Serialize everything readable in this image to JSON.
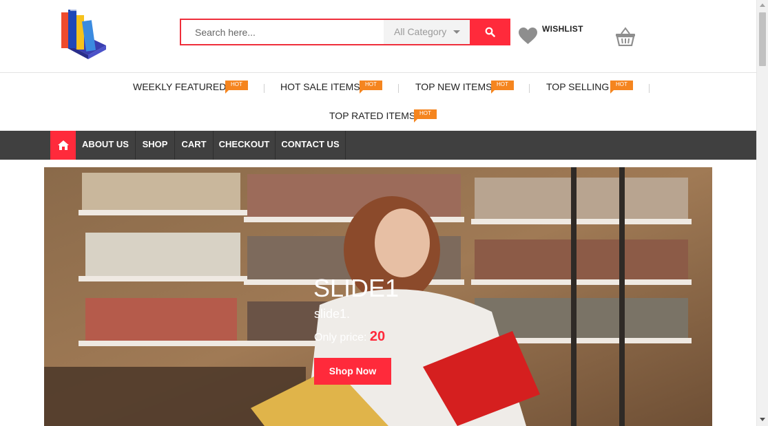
{
  "header": {
    "logo_icon": "books-logo-icon",
    "search": {
      "placeholder": "Search here...",
      "category": "All Category",
      "button_icon": "search-icon"
    },
    "wishlist": {
      "label": "WISHLIST",
      "icon": "heart-icon"
    },
    "cart": {
      "icon": "basket-icon"
    }
  },
  "category_nav": {
    "items": [
      {
        "label": "WEEKLY FEATURED",
        "badge": "HOT"
      },
      {
        "label": "HOT SALE ITEMS",
        "badge": "HOT"
      },
      {
        "label": "TOP NEW ITEMS",
        "badge": "HOT"
      },
      {
        "label": "TOP SELLING",
        "badge": "HOT"
      },
      {
        "label": "TOP RATED ITEMS",
        "badge": "HOT"
      }
    ]
  },
  "menu": {
    "home_icon": "home-icon",
    "items": [
      {
        "label": "ABOUT US"
      },
      {
        "label": "SHOP"
      },
      {
        "label": "CART"
      },
      {
        "label": "CHECKOUT"
      },
      {
        "label": "CONTACT US"
      }
    ]
  },
  "slider": {
    "title": "SLIDE1",
    "description": "slide1.",
    "price_label": "Only price:",
    "price_value": "20",
    "button_label": "Shop Now"
  },
  "colors": {
    "accent": "#ff2a3b",
    "menubar": "#404040",
    "badge": "#f5851f"
  }
}
